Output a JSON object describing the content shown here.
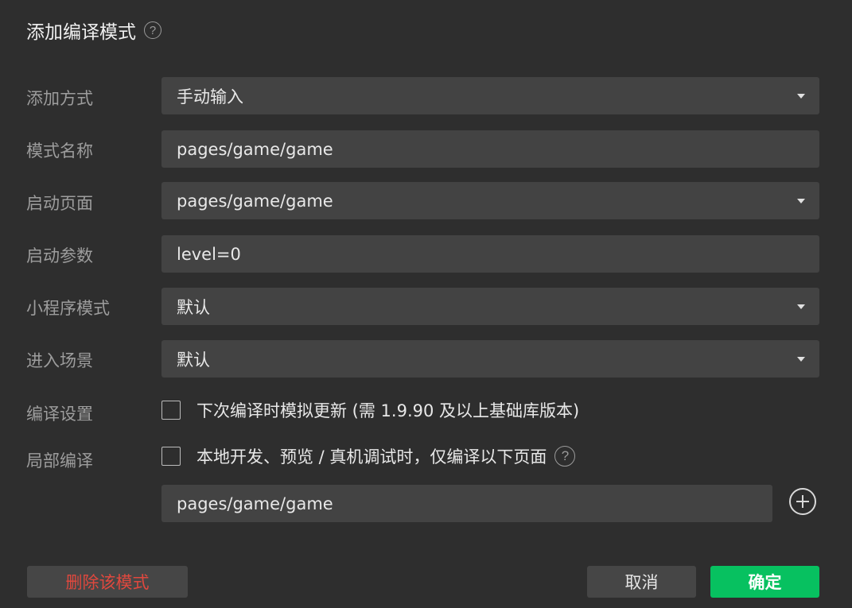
{
  "dialog": {
    "title": "添加编译模式",
    "help_glyph": "?"
  },
  "form": {
    "add_method": {
      "label": "添加方式",
      "value": "手动输入"
    },
    "mode_name": {
      "label": "模式名称",
      "value": "pages/game/game"
    },
    "launch_page": {
      "label": "启动页面",
      "value": "pages/game/game"
    },
    "launch_params": {
      "label": "启动参数",
      "value": "level=0"
    },
    "mini_program_mode": {
      "label": "小程序模式",
      "value": "默认"
    },
    "entry_scene": {
      "label": "进入场景",
      "value": "默认"
    },
    "compile_settings": {
      "label": "编译设置",
      "checkbox_text": "下次编译时模拟更新 (需 1.9.90 及以上基础库版本)",
      "checked": false
    },
    "partial_compile": {
      "label": "局部编译",
      "checkbox_text": "本地开发、预览 / 真机调试时，仅编译以下页面",
      "checked": false,
      "help_glyph": "?",
      "page_value": "pages/game/game"
    }
  },
  "footer": {
    "delete_label": "删除该模式",
    "cancel_label": "取消",
    "confirm_label": "确定"
  },
  "colors": {
    "background": "#2e2e2e",
    "field": "#434343",
    "primary": "#07c160",
    "danger": "#e0483e"
  }
}
